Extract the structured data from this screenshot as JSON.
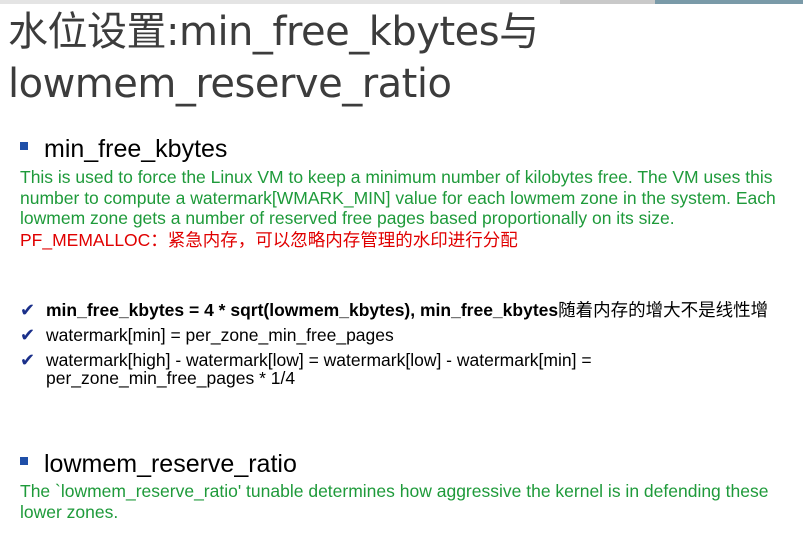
{
  "title": {
    "line1": "水位设置:min_free_kbytes与",
    "line2": "lowmem_reserve_ratio"
  },
  "section1": {
    "heading": "min_free_kbytes",
    "description": "This is used to force the Linux VM to keep a minimum number of kilobytes free. The VM uses this number to compute a watermark[WMARK_MIN] value for each lowmem zone in the system. Each lowmem zone gets a number of reserved free pages based proportionally on its size.",
    "note": "PF_MEMALLOC：紧急内存，可以忽略内存管理的水印进行分配"
  },
  "checks": [
    {
      "bold": "min_free_kbytes = 4 * sqrt(lowmem_kbytes), min_free_kbytes",
      "text": "随着内存的增大不是线性增"
    },
    {
      "bold": "",
      "text": "watermark[min] = per_zone_min_free_pages"
    },
    {
      "bold": "",
      "text": "watermark[high] - watermark[low] = watermark[low] - watermark[min] = per_zone_min_free_pages * 1/4"
    }
  ],
  "section2": {
    "heading": "lowmem_reserve_ratio",
    "description": "The `lowmem_reserve_ratio' tunable determines how aggressive the kernel is in defending these lower zones."
  },
  "colors": {
    "title": "#3c3c3c",
    "green_text": "#1e9a3a",
    "red_text": "#e00000",
    "bullet": "#1f4fa8",
    "check": "#1a2f8a",
    "topbar_light": "#dcdcdc",
    "topbar_accent": "#7a9aa8"
  }
}
